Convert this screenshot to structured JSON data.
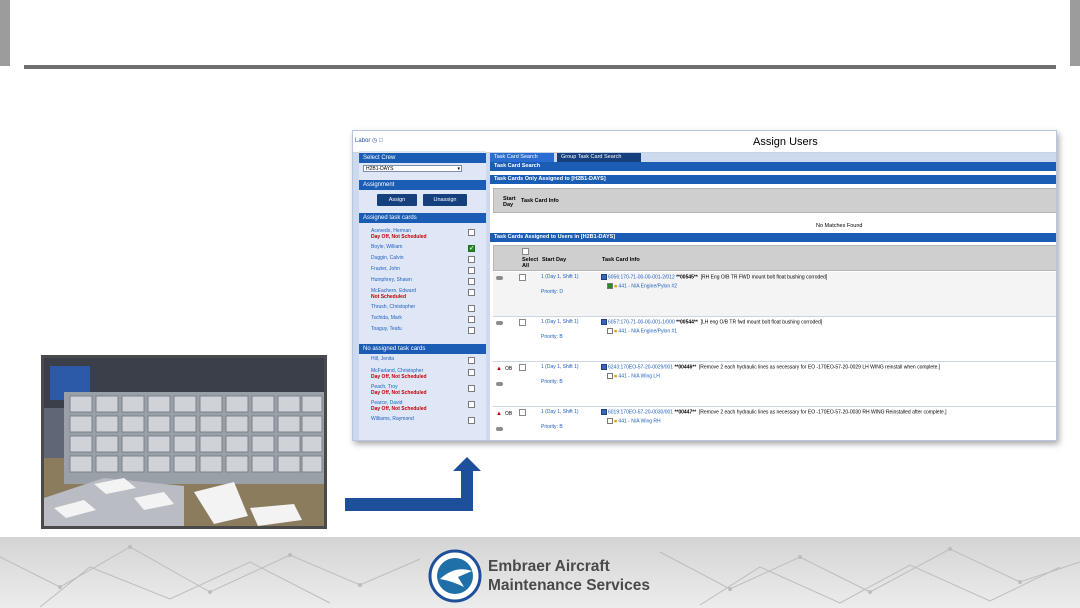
{
  "window": {
    "title": "Assign Users",
    "toolbar_text": "Labor"
  },
  "left_panel": {
    "select_crew_header": "Select Crew",
    "crew_value": "H2B1-DAYS",
    "assignment_header": "Assignment",
    "assign_label": "Assign",
    "unassign_label": "Unassign",
    "assigned_header": "Assigned task cards",
    "assigned": [
      {
        "name": "Acevedo, Herman",
        "status": "Day Off, Not Scheduled",
        "checked": false
      },
      {
        "name": "Boyle, William",
        "status": "",
        "checked": true
      },
      {
        "name": "Duggin, Calvin",
        "status": "",
        "checked": false
      },
      {
        "name": "Frazier, John",
        "status": "",
        "checked": false
      },
      {
        "name": "Humphrey, Shawn",
        "status": "",
        "checked": false
      },
      {
        "name": "McEachern, Edward",
        "status": "Not Scheduled",
        "checked": false
      },
      {
        "name": "Thrush, Christopher",
        "status": "",
        "checked": false
      },
      {
        "name": "Tschida, Mark",
        "status": "",
        "checked": false
      },
      {
        "name": "Toaguy, Teafu",
        "status": "",
        "checked": false
      }
    ],
    "unassigned_header": "No assigned task cards",
    "unassigned": [
      {
        "name": "Hill, Jenita",
        "status": "",
        "checked": false
      },
      {
        "name": "McFarland, Christopher",
        "status": "Day Off, Not Scheduled",
        "checked": false
      },
      {
        "name": "Peach, Troy",
        "status": "Day Off, Not Scheduled",
        "checked": false
      },
      {
        "name": "Pearce, David",
        "status": "Day Off, Not Scheduled",
        "checked": false
      },
      {
        "name": "Williams, Raymond",
        "status": "",
        "checked": false
      }
    ]
  },
  "tabs": [
    {
      "label": "Task Card Search",
      "selected": true
    },
    {
      "label": "Group Task Card Search",
      "selected": false
    }
  ],
  "sections": {
    "search": "Task Card Search",
    "only_assigned": "Task Cards Only Assigned to [H2B1-DAYS]",
    "assigned_users": "Task Cards Assigned to Users in [H2B1-DAYS]"
  },
  "table1": {
    "col_start": "Start Day",
    "col_info": "Task Card Info",
    "empty": "No Matches Found"
  },
  "table2": {
    "col_select": "Select All",
    "col_start": "Start Day",
    "col_info": "Task Card Info"
  },
  "rows": [
    {
      "day": "1 (Day 1, Shift 1)",
      "priority": "Priority: D",
      "code": "6056:170-71-00-00-001-2/012",
      "num": "**00545**",
      "desc": "[RH Eng O/B TR FWD mount bolt float bushing corroded]",
      "sub": "441 - N/A Engine/Pylon #2",
      "ob": false
    },
    {
      "day": "1 (Day 1, Shift 1)",
      "priority": "Priority: B",
      "code": "6057:170-71-00-00-001-1/000",
      "num": "**00544**",
      "desc": "[LH eng O/B TR fwd mount bolt float bushing corroded]",
      "sub": "441 - N/A Engine/Pylon #1",
      "ob": false
    },
    {
      "day": "1 (Day 1, Shift 1)",
      "priority": "Priority: B",
      "code": "6243:170EO-57-20-0029/001",
      "num": "**00446**",
      "desc": "[Remove 2 each hydraulic lines as necessary for EO -170EO-57-20-0029 LH WING reinstall when complete.]",
      "sub": "441 - N/A Wing LH",
      "ob": true
    },
    {
      "day": "1 (Day 1, Shift 1)",
      "priority": "Priority: B",
      "code": "6019:170EO-57-20-0030/001",
      "num": "**00447**",
      "desc": "[Remove 2 each hydraulic lines as necessary for EO -170EO-57-20-0030 RH WING Reinstalled after complete.]",
      "sub": "441 - N/A Wing RH",
      "ob": true
    }
  ],
  "ob_label": "OB",
  "brand": {
    "line1": "Embraer Aircraft",
    "line2": "Maintenance Services"
  },
  "colors": {
    "accent": "#1b5cb5",
    "arrow": "#1d4f9a",
    "status_red": "#c00000"
  }
}
